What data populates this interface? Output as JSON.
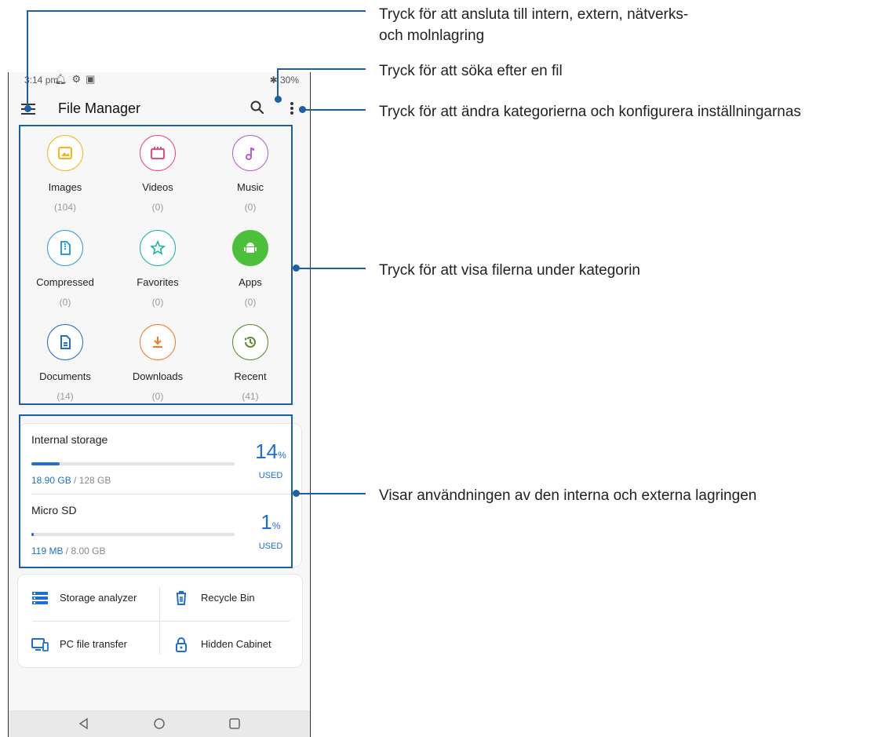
{
  "status_bar": {
    "time": "3:14 pm",
    "battery": "30%"
  },
  "appbar": {
    "title": "File Manager"
  },
  "categories": [
    {
      "name": "Images",
      "count": "(104)",
      "icon": "image-icon",
      "color": "#f2b51e"
    },
    {
      "name": "Videos",
      "count": "(0)",
      "icon": "clapperboard-icon",
      "color": "#e84a7a"
    },
    {
      "name": "Music",
      "count": "(0)",
      "icon": "music-note-icon",
      "color": "#b45fcf"
    },
    {
      "name": "Compressed",
      "count": "(0)",
      "icon": "zip-file-icon",
      "color": "#2a9fe0"
    },
    {
      "name": "Favorites",
      "count": "(0)",
      "icon": "star-icon",
      "color": "#18b5a6"
    },
    {
      "name": "Apps",
      "count": "(0)",
      "icon": "android-icon",
      "color": "#4cbf3b"
    },
    {
      "name": "Documents",
      "count": "(14)",
      "icon": "document-icon",
      "color": "#1f6fd0"
    },
    {
      "name": "Downloads",
      "count": "(0)",
      "icon": "download-icon",
      "color": "#ef7a2b"
    },
    {
      "name": "Recent",
      "count": "(41)",
      "icon": "history-icon",
      "color": "#5d8a2a"
    }
  ],
  "storage": [
    {
      "name": "Internal storage",
      "used": "18.90 GB",
      "total": " / 128 GB",
      "percent": "14",
      "percent_sign": "%",
      "used_label": "USED",
      "fraction": 0.14
    },
    {
      "name": "Micro SD",
      "used": "119 MB",
      "total": " / 8.00 GB",
      "percent": "1",
      "percent_sign": "%",
      "used_label": "USED",
      "fraction": 0.01
    }
  ],
  "tools": [
    {
      "label": "Storage analyzer",
      "icon": "storage-analyzer-icon"
    },
    {
      "label": "Recycle Bin",
      "icon": "trash-icon"
    },
    {
      "label": "PC file transfer",
      "icon": "pc-transfer-icon"
    },
    {
      "label": "Hidden Cabinet",
      "icon": "lock-icon"
    }
  ],
  "callouts": {
    "menu_line1": "Tryck för att ansluta till intern, extern, nätverks-",
    "menu_line2": "och molnlagring",
    "search": "Tryck för att söka efter en fil",
    "more": "Tryck för att ändra kategorierna och konfigurera inställningarnas",
    "categories": "Tryck för att visa filerna under kategorin",
    "storage": "Visar användningen av den interna och externa lagringen"
  },
  "colors": {
    "accent": "#1e6fd1",
    "callout": "#1b5fa5"
  }
}
